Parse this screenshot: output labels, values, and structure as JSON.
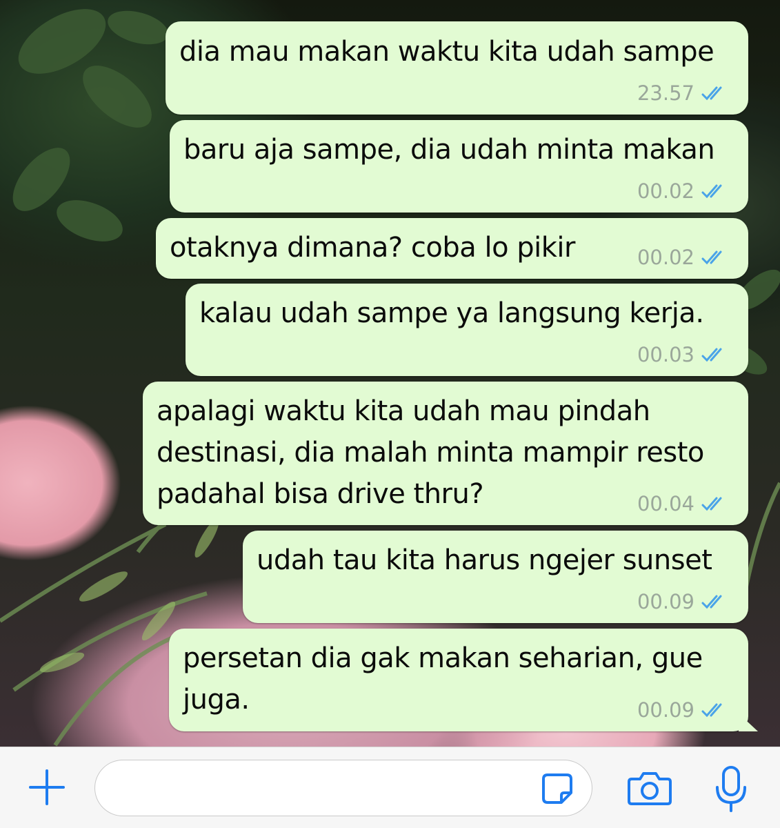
{
  "theme": {
    "bubble_color": "#e2fbd3",
    "tick_color": "#4aa3e8",
    "icon_color": "#1e7cf0"
  },
  "messages": [
    {
      "lines": [
        "dia mau makan waktu kita udah sampe"
      ],
      "time": "23.57",
      "status": "read"
    },
    {
      "lines": [
        "baru aja sampe, dia udah minta makan"
      ],
      "time": "00.02",
      "status": "read"
    },
    {
      "lines": [
        "otaknya dimana? coba lo pikir"
      ],
      "time": "00.02",
      "status": "read"
    },
    {
      "lines": [
        "kalau udah sampe ya langsung kerja."
      ],
      "time": "00.03",
      "status": "read"
    },
    {
      "lines": [
        "apalagi waktu kita udah mau pindah",
        "destinasi, dia malah minta mampir resto",
        "padahal bisa drive thru?"
      ],
      "time": "00.04",
      "status": "read"
    },
    {
      "lines": [
        "udah tau kita harus ngejer sunset"
      ],
      "time": "00.09",
      "status": "read"
    },
    {
      "lines": [
        "persetan dia gak makan seharian, gue",
        "juga."
      ],
      "time": "00.09",
      "status": "read"
    }
  ],
  "composer": {
    "input_value": "",
    "icons": [
      "plus-icon",
      "sticker-icon",
      "camera-icon",
      "microphone-icon"
    ]
  }
}
